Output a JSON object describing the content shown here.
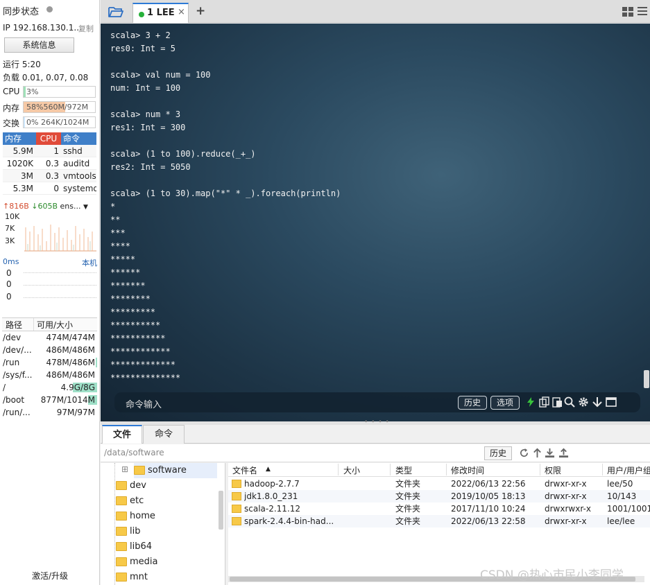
{
  "sidebar": {
    "title": "同步状态",
    "ip": "IP 192.168.130.1...",
    "copy": "复制",
    "sysinfo": "系统信息",
    "uptime": "运行 5:20",
    "load": "负载 0.01, 0.07, 0.08",
    "cpu": {
      "label": "CPU",
      "text": "3%",
      "fraction": 0.03,
      "color": "#9fe0b8"
    },
    "mem": {
      "label": "内存",
      "text": "58%560M/972M",
      "fraction": 0.58,
      "color": "#f6c9a6"
    },
    "swap": {
      "label": "交换",
      "text": "0% 264K/1024M",
      "fraction": 0.0,
      "color": "#cfe8ff"
    },
    "proc_headers": {
      "mem": "内存",
      "cpu": "CPU",
      "cmd": "命令"
    },
    "processes": [
      {
        "mem": "5.9M",
        "cpu": "1",
        "cmd": "sshd"
      },
      {
        "mem": "1020K",
        "cpu": "0.3",
        "cmd": "auditd"
      },
      {
        "mem": "3M",
        "cpu": "0.3",
        "cmd": "vmtools"
      },
      {
        "mem": "5.3M",
        "cpu": "0",
        "cmd": "systemd"
      }
    ],
    "net": {
      "up": "↑816B",
      "down": "↓605B",
      "iface": "ens...",
      "yticks": [
        "10K",
        "7K",
        "3K"
      ]
    },
    "latency": {
      "label": "0ms",
      "local": "本机",
      "values": [
        "0",
        "0",
        "0"
      ]
    },
    "disk_headers": {
      "path": "路径",
      "size": "可用/大小"
    },
    "disks": [
      {
        "path": "/dev",
        "size": "474M/474M",
        "used": 0.0
      },
      {
        "path": "/dev/...",
        "size": "486M/486M",
        "used": 0.0
      },
      {
        "path": "/run",
        "size": "478M/486M",
        "used": 0.02
      },
      {
        "path": "/sys/f...",
        "size": "486M/486M",
        "used": 0.0
      },
      {
        "path": "/",
        "size": "4.9G/8G",
        "used": 0.39
      },
      {
        "path": "/boot",
        "size": "877M/1014M",
        "used": 0.14
      },
      {
        "path": "/run/...",
        "size": "97M/97M",
        "used": 0.0
      }
    ],
    "activate": "激活/升级"
  },
  "tabs": {
    "session_title": "1 LEE",
    "close": "×",
    "add": "+"
  },
  "terminal": {
    "lines": [
      "scala> 3 + 2",
      "res0: Int = 5",
      "",
      "scala> val num = 100",
      "num: Int = 100",
      "",
      "scala> num * 3",
      "res1: Int = 300",
      "",
      "scala> (1 to 100).reduce(_+_)",
      "res2: Int = 5050",
      "",
      "scala> (1 to 30).map(\"*\" * _).foreach(println)",
      "*",
      "**",
      "***",
      "****",
      "*****",
      "******",
      "*******",
      "********",
      "*********",
      "**********",
      "***********",
      "************",
      "*************",
      "**************"
    ],
    "cmd_placeholder": "命令输入",
    "history_btn": "历史",
    "options_btn": "选项"
  },
  "file_panel": {
    "tab_file": "文件",
    "tab_cmd": "命令",
    "path": "/data/software",
    "history": "历史",
    "tree": [
      "software",
      "dev",
      "etc",
      "home",
      "lib",
      "lib64",
      "media",
      "mnt"
    ],
    "columns": {
      "name": "文件名",
      "size": "大小",
      "type": "类型",
      "mtime": "修改时间",
      "perm": "权限",
      "owner": "用户/用户组"
    },
    "files": [
      {
        "name": "hadoop-2.7.7",
        "size": "",
        "type": "文件夹",
        "mtime": "2022/06/13 22:56",
        "perm": "drwxr-xr-x",
        "owner": "lee/50"
      },
      {
        "name": "jdk1.8.0_231",
        "size": "",
        "type": "文件夹",
        "mtime": "2019/10/05 18:13",
        "perm": "drwxr-xr-x",
        "owner": "10/143"
      },
      {
        "name": "scala-2.11.12",
        "size": "",
        "type": "文件夹",
        "mtime": "2017/11/10 10:24",
        "perm": "drwxrwxr-x",
        "owner": "1001/1001"
      },
      {
        "name": "spark-2.4.4-bin-had...",
        "size": "",
        "type": "文件夹",
        "mtime": "2022/06/13 22:58",
        "perm": "drwxr-xr-x",
        "owner": "lee/lee"
      }
    ]
  },
  "watermark": "CSDN @热心市民小李同学"
}
